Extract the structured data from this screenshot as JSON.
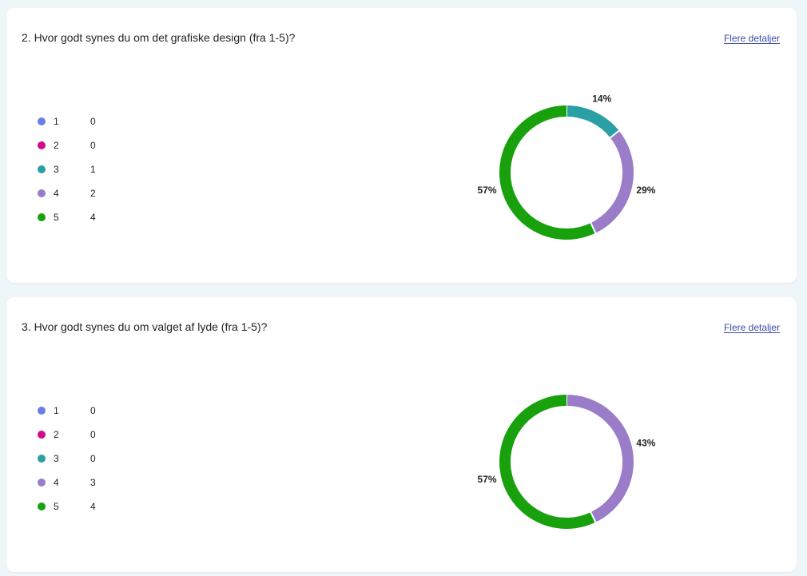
{
  "details_label": "Flere detaljer",
  "questions": [
    {
      "title": "2. Hvor godt synes du om det grafiske design (fra 1-5)?",
      "legend": [
        {
          "label": "1",
          "count": "0",
          "color": "#6a7ee3"
        },
        {
          "label": "2",
          "count": "0",
          "color": "#d10a8a"
        },
        {
          "label": "3",
          "count": "1",
          "color": "#2aa0a4"
        },
        {
          "label": "4",
          "count": "2",
          "color": "#9a7cc8"
        },
        {
          "label": "5",
          "count": "4",
          "color": "#18a10c"
        }
      ],
      "chart_data": {
        "type": "pie",
        "categories": [
          "1",
          "2",
          "3",
          "4",
          "5"
        ],
        "values": [
          0,
          0,
          1,
          2,
          4
        ],
        "percent_labels": [
          "",
          "",
          "14%",
          "29%",
          "57%"
        ]
      }
    },
    {
      "title": "3. Hvor godt synes du om valget af lyde (fra 1-5)?",
      "legend": [
        {
          "label": "1",
          "count": "0",
          "color": "#6a7ee3"
        },
        {
          "label": "2",
          "count": "0",
          "color": "#d10a8a"
        },
        {
          "label": "3",
          "count": "0",
          "color": "#2aa0a4"
        },
        {
          "label": "4",
          "count": "3",
          "color": "#9a7cc8"
        },
        {
          "label": "5",
          "count": "4",
          "color": "#18a10c"
        }
      ],
      "chart_data": {
        "type": "pie",
        "categories": [
          "1",
          "2",
          "3",
          "4",
          "5"
        ],
        "values": [
          0,
          0,
          0,
          3,
          4
        ],
        "percent_labels": [
          "",
          "",
          "",
          "43%",
          "57%"
        ]
      }
    }
  ]
}
